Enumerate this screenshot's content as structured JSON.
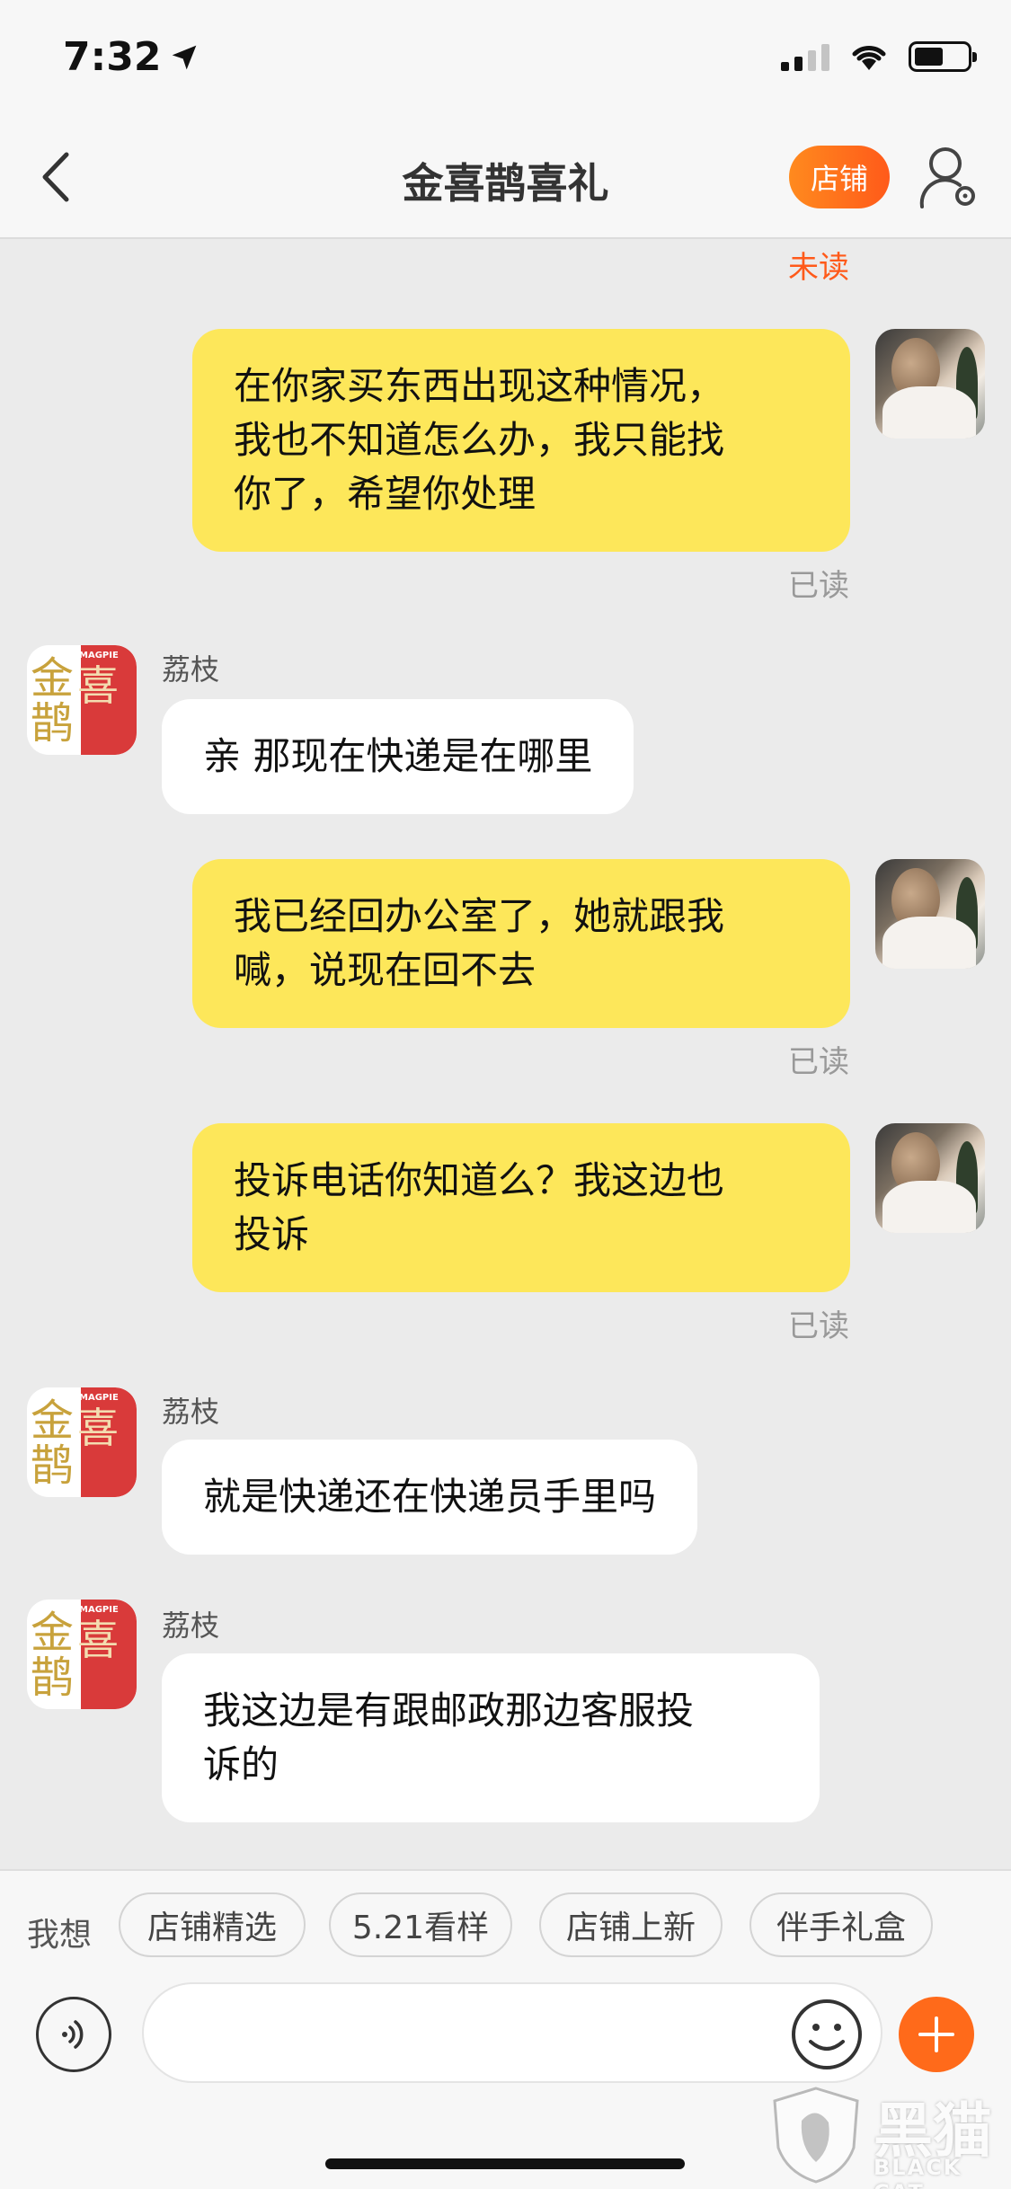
{
  "status_bar": {
    "time": "7:32"
  },
  "nav": {
    "title": "金喜鹊喜礼",
    "shop_button": "店铺"
  },
  "messages": [
    {
      "from": "me",
      "status": "未读",
      "text": "在你家买东西出现这种情况，\n我也不知道怎么办，我只能找\n你了，希望你处理",
      "receipt": "已读"
    },
    {
      "from": "shop",
      "sender": "荔枝",
      "text": "亲 那现在快递是在哪里"
    },
    {
      "from": "me",
      "text": "我已经回办公室了，她就跟我\n喊，说现在回不去",
      "receipt": "已读"
    },
    {
      "from": "me",
      "text": "投诉电话你知道么？我这边也\n投诉",
      "receipt": "已读"
    },
    {
      "from": "shop",
      "sender": "荔枝",
      "text": "就是快递还在快递员手里吗"
    },
    {
      "from": "shop",
      "sender": "荔枝",
      "text": "我这边是有跟邮政那边客服投\n诉的"
    }
  ],
  "shop_avatar": {
    "chars_left": "金鹊",
    "chars_right": "喜",
    "tag": "MAGPIE"
  },
  "quick_replies": {
    "label": "我想",
    "chips": [
      "店铺精选",
      "5.21看样",
      "店铺上新",
      "伴手礼盒"
    ]
  },
  "input": {
    "placeholder": ""
  },
  "watermark": {
    "cn": "黑猫",
    "en": "BLACK CAT"
  },
  "colors": {
    "accent": "#ff6a1a",
    "my_bubble": "#fde75a",
    "their_bubble": "#ffffff",
    "background": "#ebebeb"
  }
}
